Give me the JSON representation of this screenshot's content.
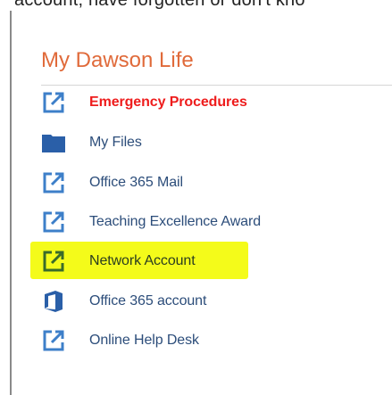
{
  "clipped_text": "account, have forgotten or don't kno",
  "section": {
    "title": "My Dawson Life"
  },
  "items": [
    {
      "label": "Emergency Procedures",
      "icon": "external-link-icon"
    },
    {
      "label": "My Files",
      "icon": "folder-icon"
    },
    {
      "label": "Office 365 Mail",
      "icon": "external-link-icon"
    },
    {
      "label": "Teaching Excellence Award",
      "icon": "external-link-icon"
    },
    {
      "label": "Network Account",
      "icon": "external-link-icon",
      "highlighted": true
    },
    {
      "label": "Office 365 account",
      "icon": "office-icon"
    },
    {
      "label": "Online Help Desk",
      "icon": "external-link-icon"
    }
  ],
  "colors": {
    "title": "#e06a3a",
    "link": "#2c4d7a",
    "emergency": "#ee1c1c",
    "icon": "#3d7fc9",
    "highlight": "#f4fb1a"
  }
}
